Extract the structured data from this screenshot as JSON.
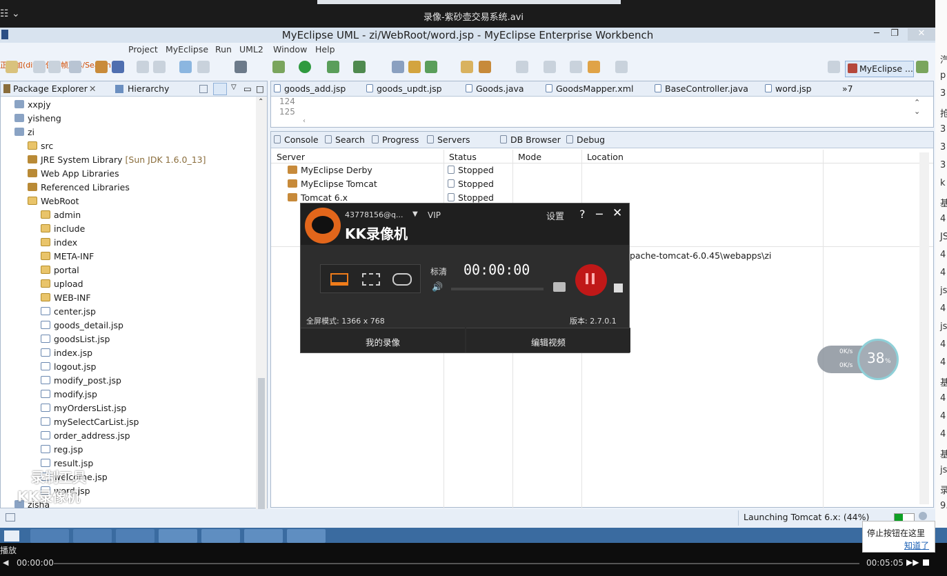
{
  "player": {
    "title": "录像-紫砂壶交易系统.avi",
    "play_label": "播放",
    "time_current": "00:00:00",
    "time_total": "00:05:05"
  },
  "window": {
    "title": "MyEclipse UML - zi/WebRoot/word.jsp - MyEclipse Enterprise Workbench",
    "minimize": "─",
    "restore": "❐",
    "close": "✕"
  },
  "menu": {
    "overlay": "正添加(dit 又保到帧版 s/Search",
    "items": [
      "Project",
      "MyEclipse",
      "Run",
      "UML2",
      "Window",
      "Help"
    ]
  },
  "perspective": {
    "label": "MyEclipse ..."
  },
  "package_explorer": {
    "tab": "Package Explorer",
    "tab2": "Hierarchy",
    "items": [
      {
        "label": "xxpjy",
        "kind": "proj"
      },
      {
        "label": "yisheng",
        "kind": "proj"
      },
      {
        "label": "zi",
        "kind": "proj"
      },
      {
        "label": "src",
        "kind": "fold"
      },
      {
        "label": "JRE System Library",
        "suffix": "[Sun JDK 1.6.0_13]",
        "kind": "jar"
      },
      {
        "label": "Web App Libraries",
        "kind": "jar"
      },
      {
        "label": "Referenced Libraries",
        "kind": "jar"
      },
      {
        "label": "WebRoot",
        "kind": "fold"
      },
      {
        "label": "admin",
        "kind": "fold"
      },
      {
        "label": "include",
        "kind": "fold"
      },
      {
        "label": "index",
        "kind": "fold"
      },
      {
        "label": "META-INF",
        "kind": "fold"
      },
      {
        "label": "portal",
        "kind": "fold"
      },
      {
        "label": "upload",
        "kind": "fold"
      },
      {
        "label": "WEB-INF",
        "kind": "fold"
      },
      {
        "label": "center.jsp",
        "kind": "jsp"
      },
      {
        "label": "goods_detail.jsp",
        "kind": "jsp"
      },
      {
        "label": "goodsList.jsp",
        "kind": "jsp"
      },
      {
        "label": "index.jsp",
        "kind": "jsp"
      },
      {
        "label": "logout.jsp",
        "kind": "jsp"
      },
      {
        "label": "modify_post.jsp",
        "kind": "jsp"
      },
      {
        "label": "modify.jsp",
        "kind": "jsp"
      },
      {
        "label": "myOrdersList.jsp",
        "kind": "jsp"
      },
      {
        "label": "mySelectCarList.jsp",
        "kind": "jsp"
      },
      {
        "label": "order_address.jsp",
        "kind": "jsp"
      },
      {
        "label": "reg.jsp",
        "kind": "jsp"
      },
      {
        "label": "result.jsp",
        "kind": "jsp"
      },
      {
        "label": "welcome.jsp",
        "kind": "jsp"
      },
      {
        "label": "word.jsp",
        "kind": "jsp"
      },
      {
        "label": "zisha",
        "kind": "proj"
      }
    ]
  },
  "editor": {
    "tabs": [
      "goods_add.jsp",
      "goods_updt.jsp",
      "Goods.java",
      "GoodsMapper.xml",
      "BaseController.java",
      "word.jsp"
    ],
    "overflow": "»7",
    "lines": [
      "124",
      "125"
    ]
  },
  "bottom": {
    "tabs": [
      "Console",
      "Search",
      "Progress",
      "Servers",
      "DB Browser",
      "Debug"
    ],
    "columns": [
      "Server",
      "Status",
      "Mode",
      "Location"
    ],
    "rows": [
      {
        "server": "MyEclipse Derby",
        "status": "Stopped"
      },
      {
        "server": "MyEclipse Tomcat",
        "status": "Stopped"
      },
      {
        "server": "Tomcat 6.x",
        "status": "Stopped"
      }
    ],
    "location": "pache-tomcat-6.0.45\\webapps\\zi"
  },
  "status": {
    "text": "Launching Tomcat 6.x: (44%)",
    "progress": 0.44
  },
  "kk": {
    "account": "43778156@q...",
    "vip": "VIP",
    "settings": "设置",
    "help": "?",
    "brand": "KK录像机",
    "quality": "标清",
    "timer": "00:00:00",
    "mode": "全屏模式: 1366 x 768",
    "version": "版本: 2.7.0.1",
    "my_recordings": "我的录像",
    "edit_video": "编辑视频"
  },
  "speed": {
    "up": "0K/s",
    "down": "0K/s",
    "percent": "38",
    "unit": "%"
  },
  "tip": {
    "text": "停止按钮在这里",
    "link": "知道了"
  },
  "watermark": {
    "line1": "录制工具",
    "line2": "KK录像机"
  },
  "right_strip": [
    "汽",
    "p",
    "3",
    "抢",
    "3",
    "3",
    "3",
    "k",
    "基",
    "4",
    "JS",
    "4",
    "4",
    "js",
    "4",
    "js",
    "4",
    "4",
    "基",
    "4",
    "4",
    "4",
    "基",
    "js",
    "录",
    "9."
  ]
}
